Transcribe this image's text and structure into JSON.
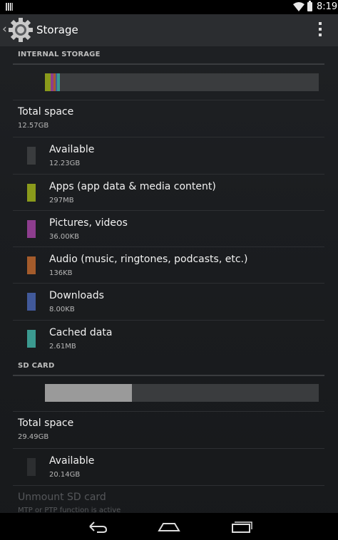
{
  "status_bar": {
    "time": "8:19",
    "icons": [
      "notification-icon",
      "wifi-icon",
      "battery-icon"
    ]
  },
  "action_bar": {
    "title": "Storage",
    "icons": [
      "up-caret-icon",
      "settings-gear-icon",
      "overflow-menu-icon"
    ]
  },
  "internal_storage": {
    "header": "INTERNAL STORAGE",
    "total_label": "Total space",
    "total_value": "12.57GB",
    "items": [
      {
        "label": "Available",
        "value": "12.23GB",
        "color": "#3a3c3e"
      },
      {
        "label": "Apps (app data & media content)",
        "value": "297MB",
        "color": "#8a9a1b"
      },
      {
        "label": "Pictures, videos",
        "value": "36.00KB",
        "color": "#8d3d8e"
      },
      {
        "label": "Audio (music, ringtones, podcasts, etc.)",
        "value": "136KB",
        "color": "#a45b2b"
      },
      {
        "label": "Downloads",
        "value": "8.00KB",
        "color": "#41599a"
      },
      {
        "label": "Cached data",
        "value": "2.61MB",
        "color": "#3b9a90"
      }
    ],
    "usage_segments": [
      {
        "name": "apps",
        "color": "#8a9a1b",
        "fraction": 0.022
      },
      {
        "name": "pictures",
        "color": "#8d3d8e",
        "fraction": 0.008
      },
      {
        "name": "audio",
        "color": "#a45b2b",
        "fraction": 0.008
      },
      {
        "name": "downloads",
        "color": "#41599a",
        "fraction": 0.006
      },
      {
        "name": "cached",
        "color": "#3b9a90",
        "fraction": 0.012
      },
      {
        "name": "available",
        "color": "#3a3c3e",
        "fraction": 0.944
      }
    ]
  },
  "sd_card": {
    "header": "SD CARD",
    "total_label": "Total space",
    "total_value": "29.49GB",
    "used_fraction": 0.317,
    "used_color": "#9a9a9a",
    "items": [
      {
        "label": "Available",
        "value": "20.14GB",
        "color": "#2c2e30"
      }
    ],
    "unmount_label": "Unmount SD card",
    "unmount_subtitle": "MTP or PTP function is active"
  },
  "nav_bar": {
    "icons": [
      "back-icon",
      "home-icon",
      "recents-icon"
    ]
  }
}
